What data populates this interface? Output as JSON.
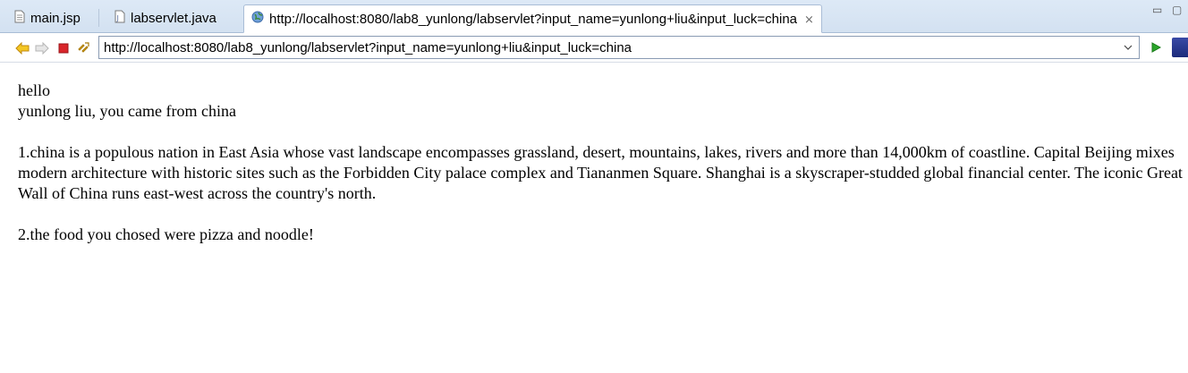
{
  "tabs": [
    {
      "label": "main.jsp",
      "icon": "file-icon",
      "active": false
    },
    {
      "label": "labservlet.java",
      "icon": "java-file-icon",
      "active": false
    },
    {
      "label": "http://localhost:8080/lab8_yunlong/labservlet?input_name=yunlong+liu&input_luck=china",
      "icon": "globe-icon",
      "active": true
    }
  ],
  "window": {
    "minimize_symbol": "▭",
    "maximize_symbol": "▢"
  },
  "toolbar": {
    "address_value": "http://localhost:8080/lab8_yunlong/labservlet?input_name=yunlong+liu&input_luck=china",
    "icons": [
      "back-arrow-icon",
      "forward-arrow-icon",
      "stop-icon",
      "refresh-icon",
      "go-icon"
    ]
  },
  "content": {
    "greeting": "hello",
    "origin_line": "yunlong liu, you came from china",
    "paragraph1": "1.china is a populous nation in East Asia whose vast landscape encompasses grassland, desert, mountains, lakes, rivers and more than 14,000km of coastline. Capital Beijing mixes modern architecture with historic sites such as the Forbidden City palace complex and Tiananmen Square. Shanghai is a skyscraper-studded global financial center. The iconic Great Wall of China runs east-west across the country's north.",
    "paragraph2": "2.the food you chosed were pizza and noodle!"
  },
  "colors": {
    "tabbar_bg": "#dde9f6",
    "go_green": "#2aa52a",
    "stop_red": "#d9262b",
    "nav_yellow": "#e8b21a"
  }
}
